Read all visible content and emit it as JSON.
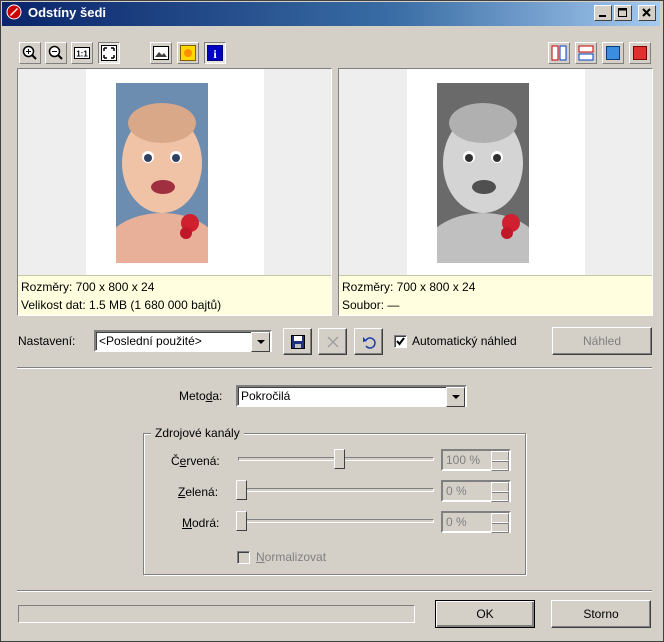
{
  "window": {
    "title": "Odstíny šedi"
  },
  "preview_left": {
    "dimensions": "Rozměry: 700 x 800 x 24",
    "data_size": "Velikost dat: 1.5 MB (1 680 000 bajtů)"
  },
  "preview_right": {
    "dimensions": "Rozměry: 700 x 800 x 24",
    "file": "Soubor: —"
  },
  "settings": {
    "label": "Nastavení:",
    "value": "<Poslední použité>",
    "auto_preview_label": "Automatický náhled",
    "auto_preview_checked": true,
    "preview_button": "Náhled"
  },
  "method": {
    "label_pre": "Meto",
    "label_ul": "d",
    "label_post": "a:",
    "value": "Pokročilá"
  },
  "channels": {
    "legend": "Zdrojové kanály",
    "red": {
      "label_pre": "Č",
      "label_ul": "e",
      "label_post": "rvená:",
      "value": "100 %",
      "level": 1.0
    },
    "green": {
      "label_pre": "",
      "label_ul": "Z",
      "label_post": "elená:",
      "value": "0 %",
      "level": 0.0
    },
    "blue": {
      "label_pre": "",
      "label_ul": "M",
      "label_post": "odrá:",
      "value": "0 %",
      "level": 0.0
    },
    "normalize_ul": "N",
    "normalize_rest": "ormalizovat"
  },
  "buttons": {
    "ok": "OK",
    "cancel": "Storno"
  }
}
